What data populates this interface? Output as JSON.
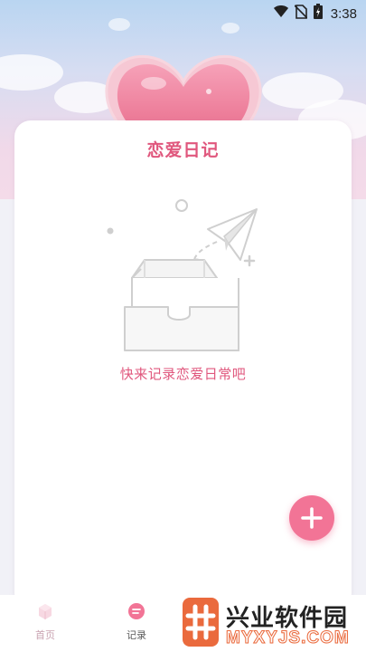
{
  "status_bar": {
    "time": "3:38",
    "icons": [
      "wifi-icon",
      "no-sim-icon",
      "battery-icon"
    ]
  },
  "header": {
    "illustration": "pink-heart-cloud-illustration"
  },
  "card": {
    "title": "恋爱日记",
    "empty_message": "快来记录恋爱日常吧",
    "empty_illustration": "empty-box-paper-plane-icon",
    "add_button_icon": "plus-icon"
  },
  "tabbar": {
    "items": [
      {
        "label": "首页",
        "icon": "home-icon",
        "active": false
      },
      {
        "label": "记录",
        "icon": "record-icon",
        "active": true
      }
    ]
  },
  "watermark": {
    "title": "兴业软件园",
    "url": "MYXYJS.COM"
  },
  "colors": {
    "accent": "#e0577d",
    "fab": "#f27496",
    "background": "#f1f1f7",
    "watermark": "#ea6a3d"
  }
}
